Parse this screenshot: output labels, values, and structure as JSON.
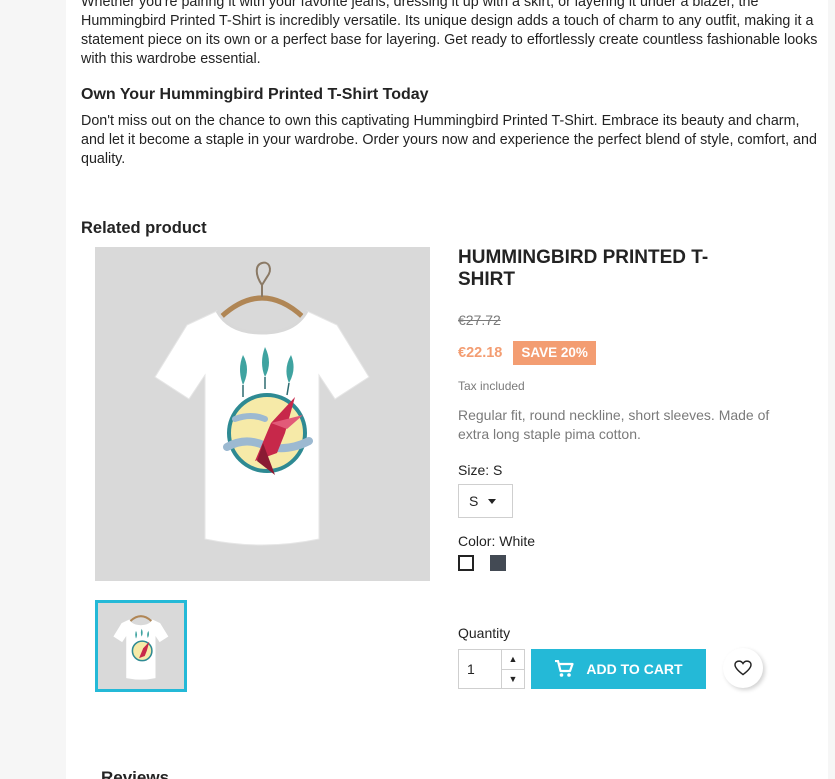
{
  "description": {
    "paragraph1": "Whether you're pairing it with your favorite jeans, dressing it up with a skirt, or layering it under a blazer, the Hummingbird Printed T-Shirt is incredibly versatile. Its unique design adds a touch of charm to any outfit, making it a statement piece on its own or a perfect base for layering. Get ready to effortlessly create countless fashionable looks with this wardrobe essential.",
    "heading": "Own Your Hummingbird Printed T-Shirt Today",
    "paragraph2": "Don't miss out on the chance to own this captivating Hummingbird Printed T-Shirt. Embrace its beauty and charm, and let it become a staple in your wardrobe. Order yours now and experience the perfect blend of style, comfort, and quality."
  },
  "related": {
    "title": "Related product",
    "product": {
      "name": "HUMMINGBIRD PRINTED T-SHIRT",
      "old_price": "€27.72",
      "price": "€22.18",
      "discount": "SAVE 20%",
      "tax": "Tax included",
      "short_description": "Regular fit, round neckline, short sleeves. Made of extra long staple pima cotton.",
      "size_label": "Size: S",
      "size_value": "S",
      "color_label": "Color: White",
      "colors": [
        "white",
        "gray"
      ],
      "quantity_label": "Quantity",
      "quantity": "1",
      "add_to_cart": "ADD TO CART",
      "wishlist_icon": "heart-icon"
    }
  },
  "bottom": {
    "heading": "Reviews"
  },
  "colors": {
    "accent": "#24b9d7",
    "price": "#f39d72",
    "text": "#232323",
    "muted": "#7a7a7a"
  }
}
